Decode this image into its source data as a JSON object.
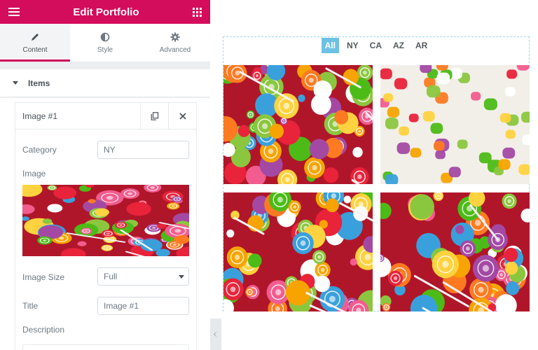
{
  "panel": {
    "title": "Edit Portfolio",
    "tabs": [
      {
        "label": "Content",
        "icon": "pencil-icon",
        "active": true
      },
      {
        "label": "Style",
        "icon": "contrast-icon",
        "active": false
      },
      {
        "label": "Advanced",
        "icon": "gear-icon",
        "active": false
      }
    ],
    "section": "Items",
    "item": {
      "title": "Image #1",
      "category_label": "Category",
      "category_value": "NY",
      "image_label": "Image",
      "image_size_label": "Image Size",
      "image_size_value": "Full",
      "title_label": "Title",
      "title_value": "Image #1",
      "description_label": "Description"
    }
  },
  "preview": {
    "filters": [
      "All",
      "NY",
      "CA",
      "AZ",
      "AR"
    ],
    "active_filter": "All",
    "accent": "#6ec1e4",
    "items": [
      {
        "subject": "lollipops and mixed candy"
      },
      {
        "subject": "sugared gumdrops"
      },
      {
        "subject": "jelly candy and lollipops"
      },
      {
        "subject": "lollipops and mixed candy"
      }
    ]
  },
  "colors": {
    "brand": "#d30c5c",
    "text": "#495157",
    "muted": "#6d7882"
  }
}
